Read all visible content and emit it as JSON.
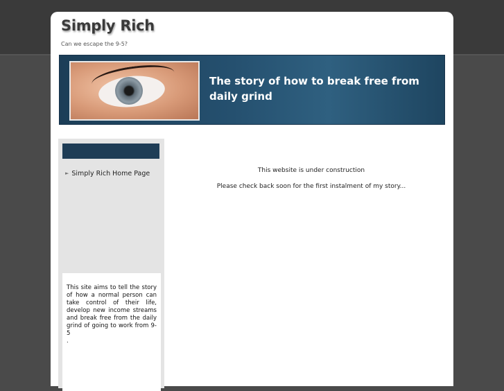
{
  "site": {
    "title": "Simply Rich",
    "tagline": "Can we escape the 9-5?"
  },
  "banner": {
    "headline": "The story of how to break free from daily grind",
    "image": "eye-photo"
  },
  "sidebar": {
    "links": [
      {
        "label": "Simply Rich Home Page",
        "icon": "bullet-icon"
      }
    ],
    "about_text": "This site aims to tell the story of how a normal person can take control of their life, develop new income streams and break free from the daily grind of going to work from 9-5",
    "about_trailing": "."
  },
  "main": {
    "status": "This website is under construction",
    "note": "Please check back soon for the first instalment of my story..."
  },
  "colors": {
    "background": "#4a4a4a",
    "page": "#ffffff",
    "banner": "#25506f",
    "sidebar": "#e4e4e4",
    "sidebar_bar": "#1f3d56"
  }
}
